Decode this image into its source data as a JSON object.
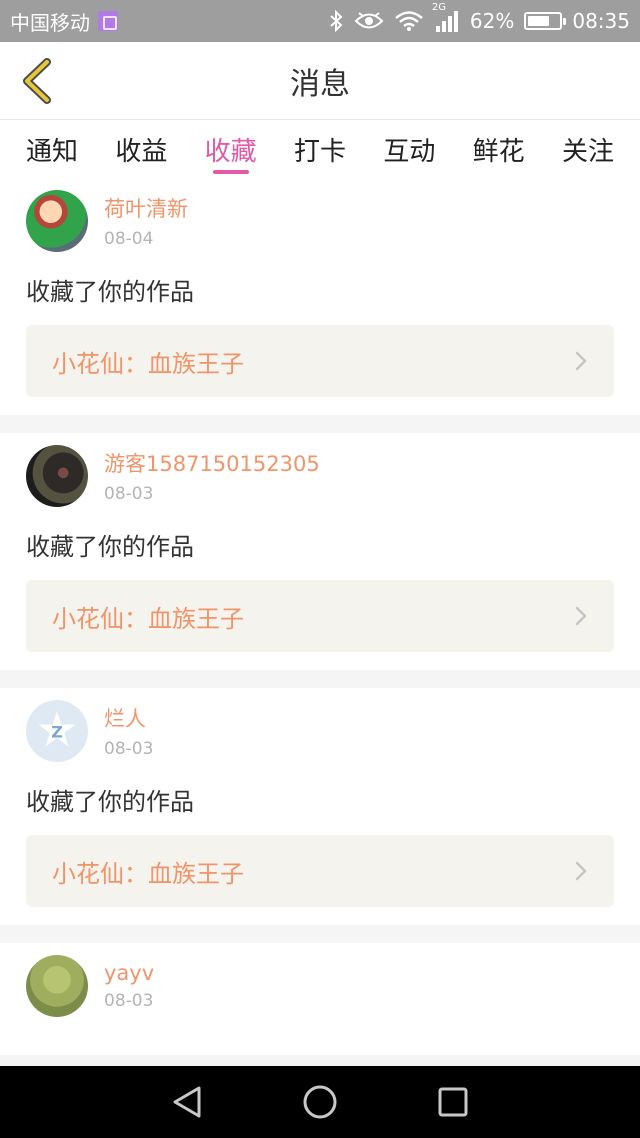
{
  "status_bar": {
    "carrier": "中国移动",
    "network_badge": "2G",
    "battery_percent": "62%",
    "time": "08:35",
    "icons": [
      "sim-card-icon",
      "bluetooth-icon",
      "eye-icon",
      "wifi-icon",
      "signal-icon",
      "battery-icon"
    ]
  },
  "header": {
    "title": "消息",
    "back_icon": "chevron-left-icon"
  },
  "tabs": [
    {
      "label": "通知",
      "active": false
    },
    {
      "label": "收益",
      "active": false
    },
    {
      "label": "收藏",
      "active": true
    },
    {
      "label": "打卡",
      "active": false
    },
    {
      "label": "互动",
      "active": false
    },
    {
      "label": "鲜花",
      "active": false
    },
    {
      "label": "关注",
      "active": false
    }
  ],
  "messages": [
    {
      "user": "荷叶清新",
      "date": "08-04",
      "action": "收藏了你的作品",
      "work": "小花仙：血族王子"
    },
    {
      "user": "游客1587150152305",
      "date": "08-03",
      "action": "收藏了你的作品",
      "work": "小花仙：血族王子"
    },
    {
      "user": "烂人",
      "date": "08-03",
      "action": "收藏了你的作品",
      "work": "小花仙：血族王子"
    },
    {
      "user": "yayv",
      "date": "08-03",
      "action": "",
      "work": ""
    }
  ],
  "colors": {
    "accent_pink": "#e25aa5",
    "name_orange": "#f0946a",
    "back_arrow_yellow": "#e8c63a",
    "status_bar_gray": "#9e9e9e"
  }
}
